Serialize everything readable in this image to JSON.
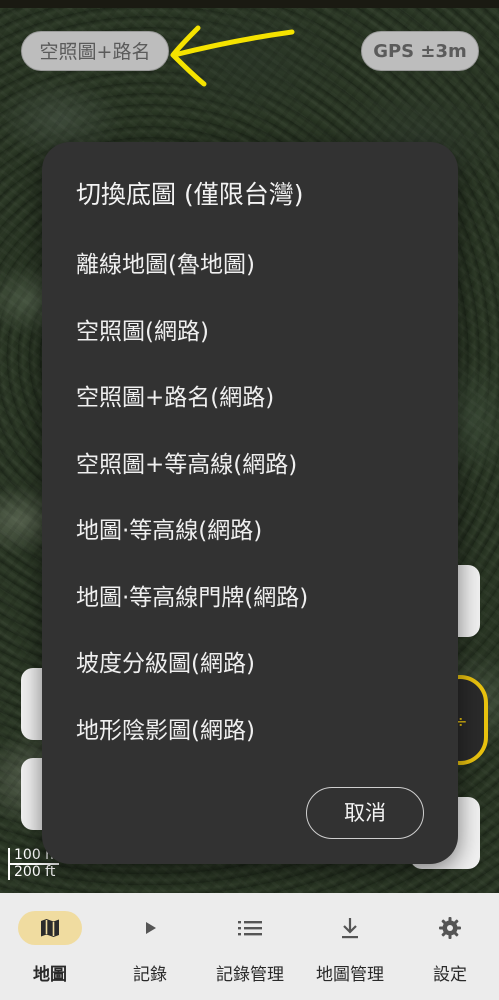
{
  "map": {
    "layer_chip_label": "空照圖+路名",
    "gps_chip_label": "GPS ±3m",
    "scale_metric": "100 m",
    "scale_imperial": "200 ft"
  },
  "dialog": {
    "title": "切換底圖 (僅限台灣)",
    "options": [
      "離線地圖(魯地圖)",
      "空照圖(網路)",
      "空照圖+路名(網路)",
      "空照圖+等高線(網路)",
      "地圖·等高線(網路)",
      "地圖·等高線門牌(網路)",
      "坡度分級圖(網路)",
      "地形陰影圖(網路)"
    ],
    "cancel_label": "取消"
  },
  "bottom_nav": {
    "items": [
      {
        "label": "地圖",
        "icon": "map-icon",
        "active": true
      },
      {
        "label": "記錄",
        "icon": "play-icon",
        "active": false
      },
      {
        "label": "記錄管理",
        "icon": "list-icon",
        "active": false
      },
      {
        "label": "地圖管理",
        "icon": "download-icon",
        "active": false
      },
      {
        "label": "設定",
        "icon": "gear-icon",
        "active": false
      }
    ]
  },
  "colors": {
    "annotation_arrow": "#f5e300",
    "active_nav_pill": "#f0dca0",
    "compass_ring": "#e9c20f",
    "dialog_background": "#323232"
  }
}
